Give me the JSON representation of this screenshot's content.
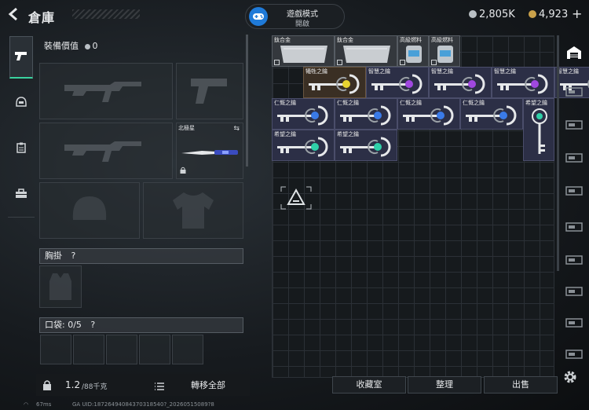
{
  "header": {
    "title": "倉庫",
    "back_icon": "back-arrow-icon"
  },
  "mode": {
    "title": "遊戲模式",
    "status": "開啟",
    "icon": "gamepad-icon",
    "accent": "#1f7ad8"
  },
  "currency": {
    "silver": "2,805K",
    "gold": "4,923",
    "add_label": "+"
  },
  "left_rail": {
    "items": [
      "pistol-icon",
      "helmet-icon",
      "clipboard-icon",
      "toolbox-icon"
    ],
    "active_accent": "#3ad29f"
  },
  "equipment": {
    "value_label": "裝備價值",
    "value": "0",
    "slot_tag": "北極星",
    "chest_label": "胸掛",
    "help": "?",
    "pocket_label": "口袋:",
    "pocket_count": "0/5"
  },
  "footer": {
    "weight": "1.2",
    "weight_max": "/88千克",
    "transfer_all": "轉移全部",
    "vault": "收藏室",
    "sort": "整理",
    "sell": "出售"
  },
  "grid_items": [
    {
      "label": "鈦合金",
      "kind": "ingot"
    },
    {
      "label": "鈦合金",
      "kind": "ingot"
    },
    {
      "label": "高級燃料",
      "kind": "fuel"
    },
    {
      "label": "高級燃料",
      "kind": "fuel"
    },
    {
      "label": "犧牲之鑰",
      "kind": "key",
      "gem": "#e8d430"
    },
    {
      "label": "智慧之鑰",
      "kind": "key",
      "gem": "#a048e0"
    },
    {
      "label": "智慧之鑰",
      "kind": "key",
      "gem": "#a048e0"
    },
    {
      "label": "智慧之鑰",
      "kind": "key",
      "gem": "#a048e0"
    },
    {
      "label": "智慧之鑰",
      "kind": "key",
      "gem": "#a048e0"
    },
    {
      "label": "仁慨之鑰",
      "kind": "key",
      "gem": "#3a7ae8"
    },
    {
      "label": "仁慨之鑰",
      "kind": "key",
      "gem": "#3a7ae8"
    },
    {
      "label": "仁慨之鑰",
      "kind": "key",
      "gem": "#3a7ae8"
    },
    {
      "label": "仁慨之鑰",
      "kind": "key",
      "gem": "#3a7ae8"
    },
    {
      "label": "希望之鑰",
      "kind": "key",
      "gem": "#2fd0a8"
    },
    {
      "label": "希望之鑰",
      "kind": "key",
      "gem": "#2fd0a8"
    },
    {
      "label": "希望之鑰",
      "kind": "key",
      "gem": "#2fd0a8"
    }
  ],
  "status": {
    "signal": "67ms",
    "uid": "GA UID:18726494084370318540?_20260515089?8"
  }
}
